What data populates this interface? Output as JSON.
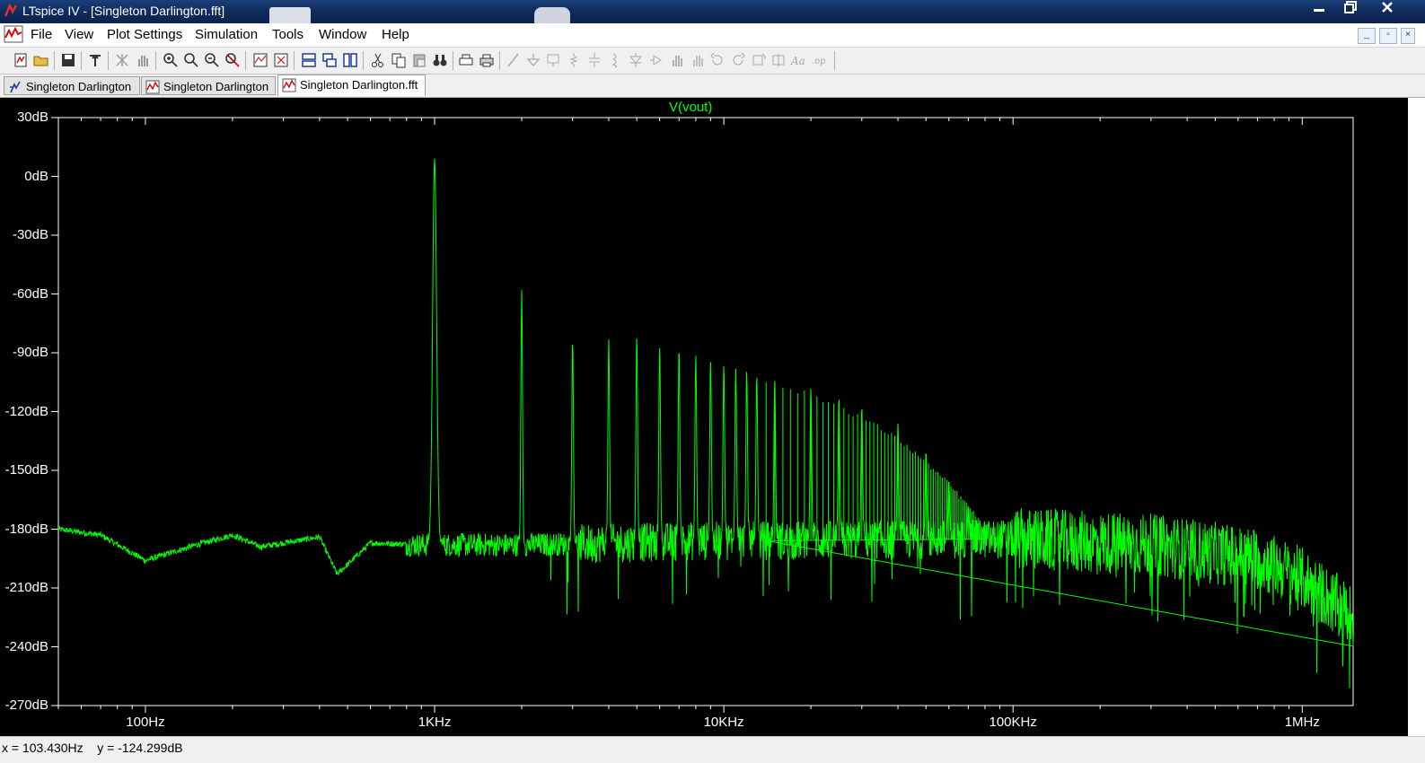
{
  "window": {
    "title": "LTspice IV - [Singleton Darlington.fft]"
  },
  "menu": {
    "items": [
      "File",
      "View",
      "Plot Settings",
      "Simulation",
      "Tools",
      "Window",
      "Help"
    ]
  },
  "tabs": [
    {
      "label": "Singleton Darlington",
      "icon": "schematic-icon",
      "active": false
    },
    {
      "label": "Singleton Darlington",
      "icon": "waveform-icon",
      "active": false
    },
    {
      "label": "Singleton Darlington.fft",
      "icon": "waveform-icon",
      "active": true
    }
  ],
  "toolbar": {
    "icons": [
      "new-schematic-icon",
      "open-icon",
      "save-icon",
      "control-panel-icon",
      "autorange-icon",
      "pan-icon",
      "zoom-in-icon",
      "zoom-area-icon",
      "zoom-out-icon",
      "zoom-cancel-icon",
      "plot-pane-icon",
      "delete-pane-icon",
      "tile-horizontal-icon",
      "cascade-icon",
      "tile-vertical-icon",
      "cut-icon",
      "copy-icon",
      "paste-icon",
      "find-icon",
      "print-setup-icon",
      "print-icon",
      "wire-icon",
      "ground-icon",
      "label-icon",
      "resistor-icon",
      "capacitor-icon",
      "inductor-icon",
      "diode-icon",
      "component-icon",
      "move-icon",
      "drag-icon",
      "undo-icon",
      "redo-icon",
      "rotate-icon",
      "mirror-icon",
      "text-icon",
      "spice-directive-icon"
    ]
  },
  "colors": {
    "trace": "#00ff00",
    "background": "#000000",
    "axis": "#ffffff"
  },
  "chart_data": {
    "type": "line",
    "title": "V(vout)",
    "xlabel": "",
    "ylabel": "",
    "x_scale": "log",
    "xlim": [
      50,
      1500000
    ],
    "ylim": [
      -270,
      30
    ],
    "x_ticks": [
      {
        "label": "100Hz",
        "value": 100
      },
      {
        "label": "1KHz",
        "value": 1000
      },
      {
        "label": "10KHz",
        "value": 10000
      },
      {
        "label": "100KHz",
        "value": 100000
      },
      {
        "label": "1MHz",
        "value": 1000000
      }
    ],
    "y_ticks": [
      {
        "label": "30dB",
        "value": 30
      },
      {
        "label": "0dB",
        "value": 0
      },
      {
        "label": "-30dB",
        "value": -30
      },
      {
        "label": "-60dB",
        "value": -60
      },
      {
        "label": "-90dB",
        "value": -90
      },
      {
        "label": "-120dB",
        "value": -120
      },
      {
        "label": "-150dB",
        "value": -150
      },
      {
        "label": "-180dB",
        "value": -180
      },
      {
        "label": "-210dB",
        "value": -210
      },
      {
        "label": "-240dB",
        "value": -240
      },
      {
        "label": "-270dB",
        "value": -270
      }
    ],
    "grid": false,
    "series": [
      {
        "name": "V(vout)",
        "fundamental": {
          "freq": 1000,
          "db": 9
        },
        "harmonics": [
          {
            "freq": 2000,
            "db": -58
          },
          {
            "freq": 3000,
            "db": -83
          },
          {
            "freq": 4000,
            "db": -83
          },
          {
            "freq": 5000,
            "db": -81
          },
          {
            "freq": 6000,
            "db": -86
          },
          {
            "freq": 7000,
            "db": -87
          },
          {
            "freq": 8000,
            "db": -91
          },
          {
            "freq": 9000,
            "db": -94
          },
          {
            "freq": 10000,
            "db": -96
          },
          {
            "freq": 11000,
            "db": -98
          },
          {
            "freq": 12000,
            "db": -99
          },
          {
            "freq": 13000,
            "db": -101
          },
          {
            "freq": 15000,
            "db": -103
          },
          {
            "freq": 20000,
            "db": -108
          },
          {
            "freq": 25000,
            "db": -112
          },
          {
            "freq": 30000,
            "db": -117
          },
          {
            "freq": 40000,
            "db": -126
          },
          {
            "freq": 50000,
            "db": -140
          },
          {
            "freq": 60000,
            "db": -155
          },
          {
            "freq": 70000,
            "db": -168
          }
        ],
        "noise_floor": [
          {
            "freq": 50,
            "db": -180
          },
          {
            "freq": 70,
            "db": -183
          },
          {
            "freq": 100,
            "db": -196
          },
          {
            "freq": 150,
            "db": -188
          },
          {
            "freq": 200,
            "db": -183
          },
          {
            "freq": 250,
            "db": -189
          },
          {
            "freq": 400,
            "db": -184
          },
          {
            "freq": 460,
            "db": -203
          },
          {
            "freq": 600,
            "db": -187
          },
          {
            "freq": 900,
            "db": -188
          },
          {
            "freq": 2000,
            "db": -188
          },
          {
            "freq": 10000,
            "db": -186
          },
          {
            "freq": 100000,
            "db": -185
          },
          {
            "freq": 300000,
            "db": -188
          },
          {
            "freq": 700000,
            "db": -195
          },
          {
            "freq": 1000000,
            "db": -205
          },
          {
            "freq": 1500000,
            "db": -225
          }
        ]
      }
    ]
  },
  "status": {
    "x_readout": "x = 103.430Hz",
    "y_readout": "y = -124.299dB"
  }
}
